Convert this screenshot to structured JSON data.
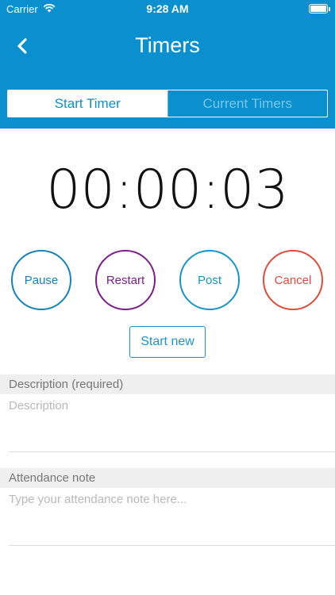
{
  "status_bar": {
    "carrier": "Carrier",
    "time": "9:28 AM",
    "wifi_icon": "wifi-icon",
    "battery_icon": "battery-icon"
  },
  "nav": {
    "back_icon": "chevron-left-icon",
    "title": "Timers"
  },
  "tabs": {
    "items": [
      {
        "label": "Start Timer",
        "active": true
      },
      {
        "label": "Current Timers",
        "active": false
      }
    ]
  },
  "timer": {
    "display": "00:00:03"
  },
  "actions": {
    "pause": "Pause",
    "restart": "Restart",
    "post": "Post",
    "cancel": "Cancel",
    "start_new": "Start new"
  },
  "description": {
    "header": "Description (required)",
    "placeholder": "Description",
    "value": ""
  },
  "attendance": {
    "header": "Attendance note",
    "placeholder": "Type your attendance note here...",
    "value": ""
  },
  "colors": {
    "brand_blue": "#0a8fcf",
    "pause": "#1683b8",
    "restart": "#7c1e8c",
    "post": "#1a93c9",
    "cancel": "#e24a3b"
  }
}
